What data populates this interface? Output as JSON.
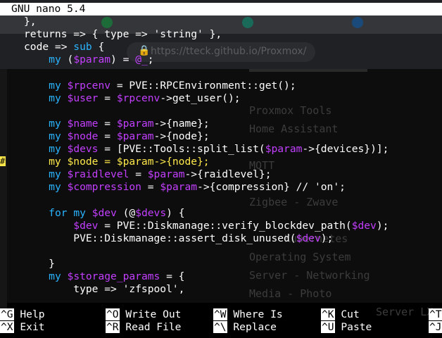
{
  "title": "GNU nano 5.4",
  "background": {
    "url": "https://tteck.github.io/Proxmox/",
    "menu_items": [
      "Proxmox Tools",
      "Home Assistant",
      "MQTT",
      "Zigbee - Zwave",
      "Kubernetes",
      "Operating System",
      "Server - Networking",
      "Media - Photo",
      "Server LX"
    ]
  },
  "code_lines": [
    [
      {
        "t": "},"
      }
    ],
    [
      {
        "t": "returns => { type => 'string' },"
      }
    ],
    [
      {
        "t": "code => "
      },
      {
        "t": "sub",
        "c": "kw"
      },
      {
        "t": " {"
      }
    ],
    [
      {
        "t": "    "
      },
      {
        "t": "my",
        "c": "kw"
      },
      {
        "t": " ("
      },
      {
        "t": "$param",
        "c": "var"
      },
      {
        "t": ") = "
      },
      {
        "t": "@_",
        "c": "var"
      },
      {
        "t": ";"
      }
    ],
    [
      {
        "t": ""
      }
    ],
    [
      {
        "t": "    "
      },
      {
        "t": "my",
        "c": "kw"
      },
      {
        "t": " "
      },
      {
        "t": "$rpcenv",
        "c": "var"
      },
      {
        "t": " = PVE::RPCEnvironment::get();"
      }
    ],
    [
      {
        "t": "    "
      },
      {
        "t": "my",
        "c": "kw"
      },
      {
        "t": " "
      },
      {
        "t": "$user",
        "c": "var"
      },
      {
        "t": " = "
      },
      {
        "t": "$rpcenv",
        "c": "var"
      },
      {
        "t": "->get_user();"
      }
    ],
    [
      {
        "t": ""
      }
    ],
    [
      {
        "t": "    "
      },
      {
        "t": "my",
        "c": "kw"
      },
      {
        "t": " "
      },
      {
        "t": "$name",
        "c": "var"
      },
      {
        "t": " = "
      },
      {
        "t": "$param",
        "c": "var"
      },
      {
        "t": "->{name};"
      }
    ],
    [
      {
        "t": "    "
      },
      {
        "t": "my",
        "c": "kw"
      },
      {
        "t": " "
      },
      {
        "t": "$node",
        "c": "var"
      },
      {
        "t": " = "
      },
      {
        "t": "$param",
        "c": "var"
      },
      {
        "t": "->{node};"
      }
    ],
    [
      {
        "t": "    "
      },
      {
        "t": "my",
        "c": "kw"
      },
      {
        "t": " "
      },
      {
        "t": "$devs",
        "c": "var"
      },
      {
        "t": " = [PVE::Tools::split_list("
      },
      {
        "t": "$param",
        "c": "var"
      },
      {
        "t": "->{devices})];"
      }
    ],
    [
      {
        "t": "    my $node = $param->{node};",
        "c": "yel"
      }
    ],
    [
      {
        "t": "    "
      },
      {
        "t": "my",
        "c": "kw"
      },
      {
        "t": " "
      },
      {
        "t": "$raidlevel",
        "c": "var"
      },
      {
        "t": " = "
      },
      {
        "t": "$param",
        "c": "var"
      },
      {
        "t": "->{raidlevel};"
      }
    ],
    [
      {
        "t": "    "
      },
      {
        "t": "my",
        "c": "kw"
      },
      {
        "t": " "
      },
      {
        "t": "$compression",
        "c": "var"
      },
      {
        "t": " = "
      },
      {
        "t": "$param",
        "c": "var"
      },
      {
        "t": "->{compression} // 'on';"
      }
    ],
    [
      {
        "t": ""
      }
    ],
    [
      {
        "t": "    "
      },
      {
        "t": "for",
        "c": "kw"
      },
      {
        "t": " "
      },
      {
        "t": "my",
        "c": "kw"
      },
      {
        "t": " "
      },
      {
        "t": "$dev",
        "c": "var"
      },
      {
        "t": " (@"
      },
      {
        "t": "$devs",
        "c": "var"
      },
      {
        "t": ") {"
      }
    ],
    [
      {
        "t": "        "
      },
      {
        "t": "$dev",
        "c": "var"
      },
      {
        "t": " = PVE::Diskmanage::verify_blockdev_path("
      },
      {
        "t": "$dev",
        "c": "var"
      },
      {
        "t": ");"
      }
    ],
    [
      {
        "t": "        PVE::Diskmanage::assert_disk_unused("
      },
      {
        "t": "$dev",
        "c": "var"
      },
      {
        "t": ");"
      }
    ],
    [
      {
        "t": ""
      }
    ],
    [
      {
        "t": "    }"
      }
    ],
    [
      {
        "t": "    "
      },
      {
        "t": "my",
        "c": "kw"
      },
      {
        "t": " "
      },
      {
        "t": "$storage_params",
        "c": "var"
      },
      {
        "t": " = {"
      }
    ],
    [
      {
        "t": "        type => 'zfspool',"
      }
    ]
  ],
  "shortcuts": [
    {
      "key": "^G",
      "label": "Help"
    },
    {
      "key": "^X",
      "label": "Exit"
    },
    {
      "key": "^O",
      "label": "Write Out"
    },
    {
      "key": "^R",
      "label": "Read File"
    },
    {
      "key": "^W",
      "label": "Where Is"
    },
    {
      "key": "^\\",
      "label": "Replace"
    },
    {
      "key": "^K",
      "label": "Cut"
    },
    {
      "key": "^U",
      "label": "Paste"
    },
    {
      "key": "^T",
      "label": ""
    },
    {
      "key": "^J",
      "label": ""
    }
  ]
}
